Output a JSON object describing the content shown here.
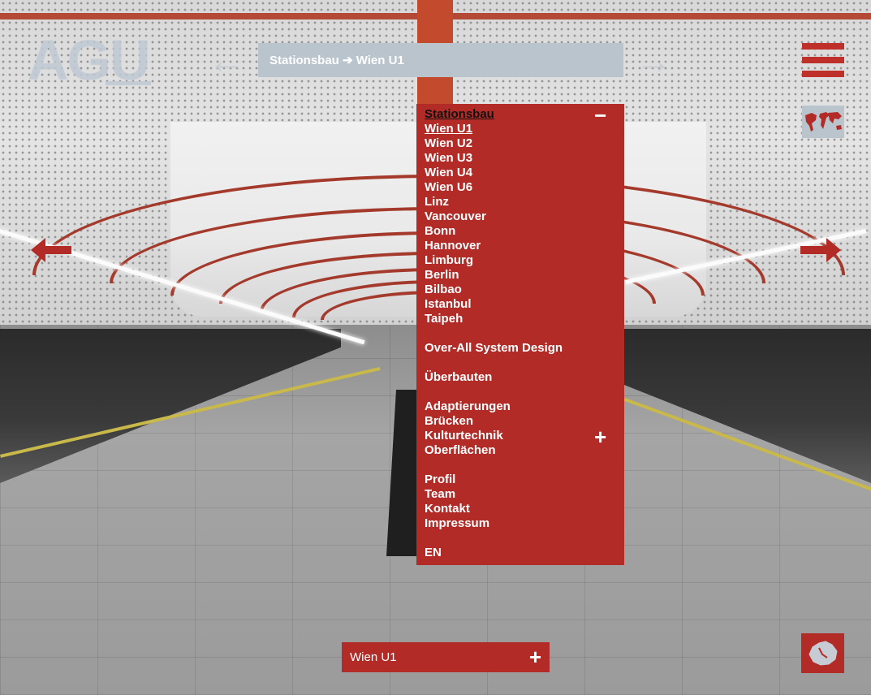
{
  "logo": {
    "text": "AGU"
  },
  "breadcrumb": {
    "text": "Stationsbau ➔ Wien U1"
  },
  "menu": {
    "items": [
      {
        "label": "Stationsbau",
        "kind": "heading"
      },
      {
        "label": "Wien U1",
        "kind": "active"
      },
      {
        "label": "Wien U2"
      },
      {
        "label": "Wien U3"
      },
      {
        "label": "Wien U4"
      },
      {
        "label": "Wien U6"
      },
      {
        "label": "Linz"
      },
      {
        "label": "Vancouver"
      },
      {
        "label": "Bonn"
      },
      {
        "label": "Hannover"
      },
      {
        "label": "Limburg"
      },
      {
        "label": "Berlin"
      },
      {
        "label": "Bilbao"
      },
      {
        "label": "Istanbul"
      },
      {
        "label": "Taipeh"
      },
      {
        "spacer": true
      },
      {
        "label": "Over-All System Design"
      },
      {
        "spacer": true
      },
      {
        "label": "Überbauten"
      },
      {
        "spacer": true
      },
      {
        "label": "Adaptierungen"
      },
      {
        "label": "Brücken"
      },
      {
        "label": "Kulturtechnik"
      },
      {
        "label": "Oberflächen"
      },
      {
        "spacer": true
      },
      {
        "label": "Profil"
      },
      {
        "label": "Team"
      },
      {
        "label": "Kontakt"
      },
      {
        "label": "Impressum"
      },
      {
        "spacer": true
      },
      {
        "label": "EN"
      }
    ],
    "collapse_symbol": "−",
    "expand_symbol": "+"
  },
  "bottom_bar": {
    "label": "Wien U1",
    "symbol": "+"
  },
  "colors": {
    "brand_red": "#b22b27",
    "panel_grey": "#b9c4cc"
  },
  "icons": {
    "menu": "hamburger-icon",
    "world": "world-map-icon",
    "prev": "arrow-left-icon",
    "next": "arrow-right-icon",
    "vienna": "vienna-map-icon"
  }
}
